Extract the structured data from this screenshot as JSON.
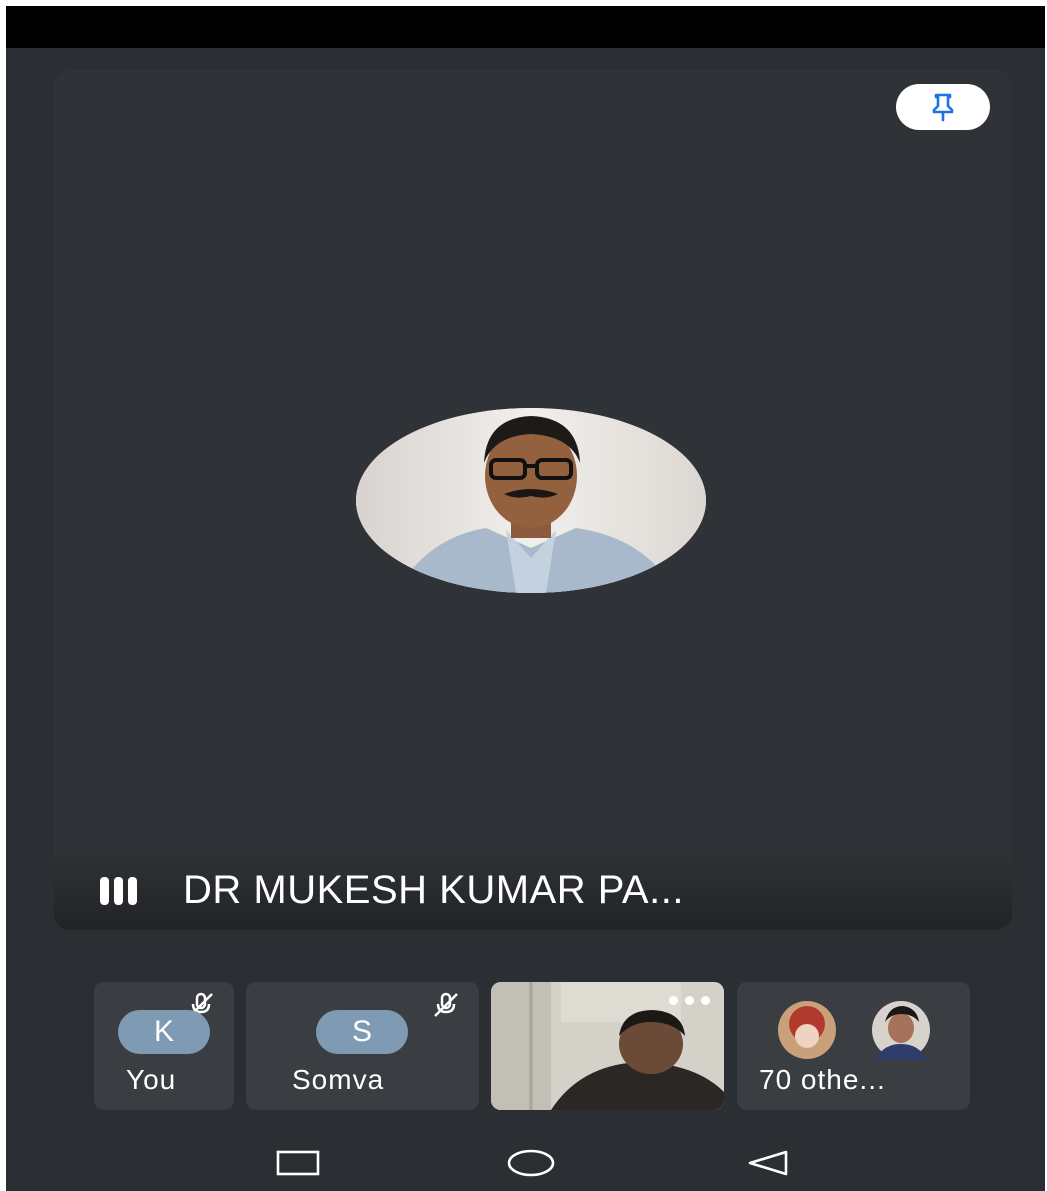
{
  "app": {
    "theme": {
      "background": "#2b2e32",
      "tile": "#3a3d41",
      "accent": "#1a73e8",
      "avatar_initial_bg": "#7f9bb3"
    }
  },
  "main_speaker": {
    "name": "DR MUKESH KUMAR PA...",
    "pin_icon": "pin-icon",
    "audio_indicator": "audio-level-icon"
  },
  "participants": [
    {
      "initial": "K",
      "label": "You",
      "muted": true
    },
    {
      "initial": "S",
      "label": "Somva",
      "muted": true
    },
    {
      "label": "",
      "has_video": true,
      "menu_icon": "more-options-icon"
    },
    {
      "label": "70 othe..."
    }
  ],
  "nav": {
    "recent": "recent-apps-icon",
    "home": "home-icon",
    "back": "back-icon"
  }
}
